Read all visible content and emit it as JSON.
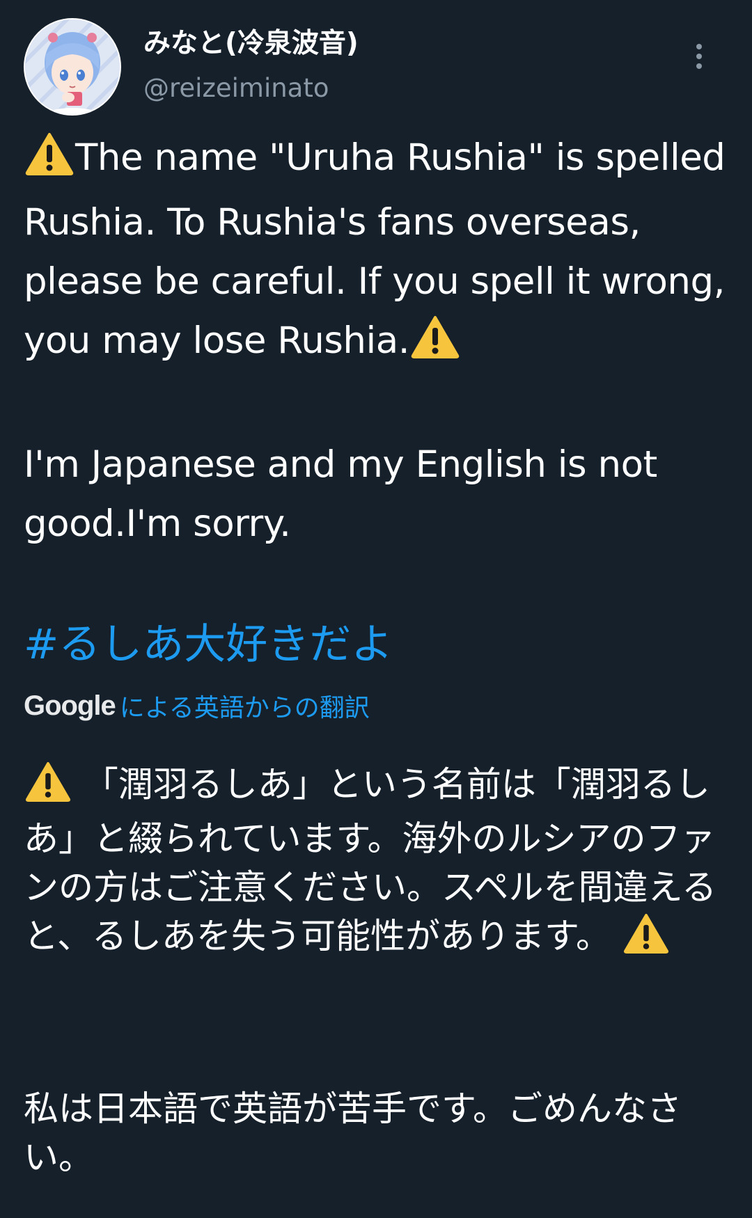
{
  "author": {
    "display_name": "みなと(冷泉波音)",
    "handle": "@reizeiminato"
  },
  "tweet": {
    "para1_part1": "The name \"Uruha Rushia\" is spelled Rushia. To Rushia's fans overseas, please be careful. If you spell it wrong, you may lose Rushia.",
    "para2": "I'm Japanese and my English is not good.I'm sorry.",
    "hashtag": "#るしあ大好きだよ"
  },
  "translation": {
    "provider": "Google",
    "label": "による英語からの翻訳",
    "para1": "「潤羽るしあ」という名前は「潤羽るしあ」と綴られています。海外のルシアのファンの方はご注意ください。スペルを間違えると、るしあを失う可能性があります。",
    "para2": "私は日本語で英語が苦手です。ごめんなさい。"
  },
  "icons": {
    "warning": "warning-icon",
    "more": "more-options-icon",
    "avatar": "avatar-image"
  },
  "colors": {
    "background": "#15202b",
    "accent": "#1d9bf0",
    "secondary_text": "#8b98a5",
    "warning": "#f7c53d"
  }
}
